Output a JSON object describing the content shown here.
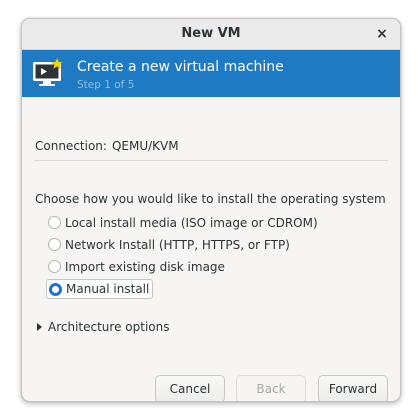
{
  "window": {
    "title": "New VM",
    "close_glyph": "×"
  },
  "banner": {
    "heading": "Create a new virtual machine",
    "step": "Step 1 of 5",
    "icon": "vm-monitor-icon",
    "bg_color": "#1f7ac4"
  },
  "connection": {
    "label": "Connection:",
    "value": "QEMU/KVM"
  },
  "install": {
    "prompt": "Choose how you would like to install the operating system",
    "options": [
      {
        "label": "Local install media (ISO image or CDROM)",
        "selected": false
      },
      {
        "label": "Network Install (HTTP, HTTPS, or FTP)",
        "selected": false
      },
      {
        "label": "Import existing disk image",
        "selected": false
      },
      {
        "label": "Manual install",
        "selected": true
      }
    ]
  },
  "architecture": {
    "label": "Architecture options",
    "expanded": false
  },
  "buttons": {
    "cancel": "Cancel",
    "back": "Back",
    "forward": "Forward"
  },
  "colors": {
    "accent": "#1c71d8"
  }
}
